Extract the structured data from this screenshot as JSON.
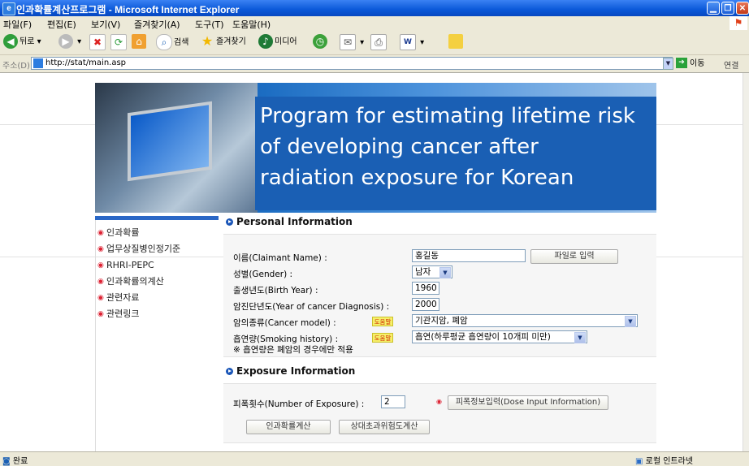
{
  "window": {
    "title": "인과확률계산프로그램 - Microsoft Internet Explorer"
  },
  "menu": [
    "파일(F)",
    "편집(E)",
    "보기(V)",
    "즐겨찾기(A)",
    "도구(T)",
    "도움말(H)"
  ],
  "toolbar": {
    "back": "뒤로",
    "search": "검색",
    "favorites": "즐겨찾기",
    "media": "미디어"
  },
  "address": {
    "label": "주소(D)",
    "url": "http://stat/main.asp",
    "go": "이동",
    "links": "연결"
  },
  "banner": {
    "line1": "Program for estimating lifetime risk",
    "line2": "of developing cancer after",
    "line3": "radiation exposure for Korean"
  },
  "sidebar": {
    "items": [
      {
        "label": "인과확률"
      },
      {
        "label": "업무상질병인정기준"
      },
      {
        "label": "RHRI-PEPC"
      },
      {
        "label": "인과확률의계산"
      },
      {
        "label": "관련자료"
      },
      {
        "label": "관련링크"
      }
    ]
  },
  "personal": {
    "title": "Personal Information",
    "name_label": "이름(Claimant Name) :",
    "name_value": "홍길동",
    "file_button": "파일로 입력",
    "gender_label": "성별(Gender) :",
    "gender_value": "남자",
    "birth_label": "출생년도(Birth Year) :",
    "birth_value": "1960",
    "diag_label": "암진단년도(Year of cancer Diagnosis) :",
    "diag_value": "2000",
    "cancer_label": "암의종류(Cancer model) :",
    "cancer_value": "기관지암, 폐암",
    "smoking_label": "흡연량(Smoking history) :",
    "smoking_value": "흡연(하루평균 흡연량이 10개피 미만)",
    "help": "도움말",
    "note": "※ 흡연량은 폐암의 경우에만 적용"
  },
  "exposure": {
    "title": "Exposure Information",
    "count_label": "피폭횟수(Number of Exposure) :",
    "count_value": "2",
    "dose_button": "피폭정보입력(Dose Input Information)",
    "calc_button": "인과확률계산",
    "relative_button": "상대초과위험도계산"
  },
  "status": {
    "left": "완료",
    "zone": "로컬 인트라넷"
  }
}
